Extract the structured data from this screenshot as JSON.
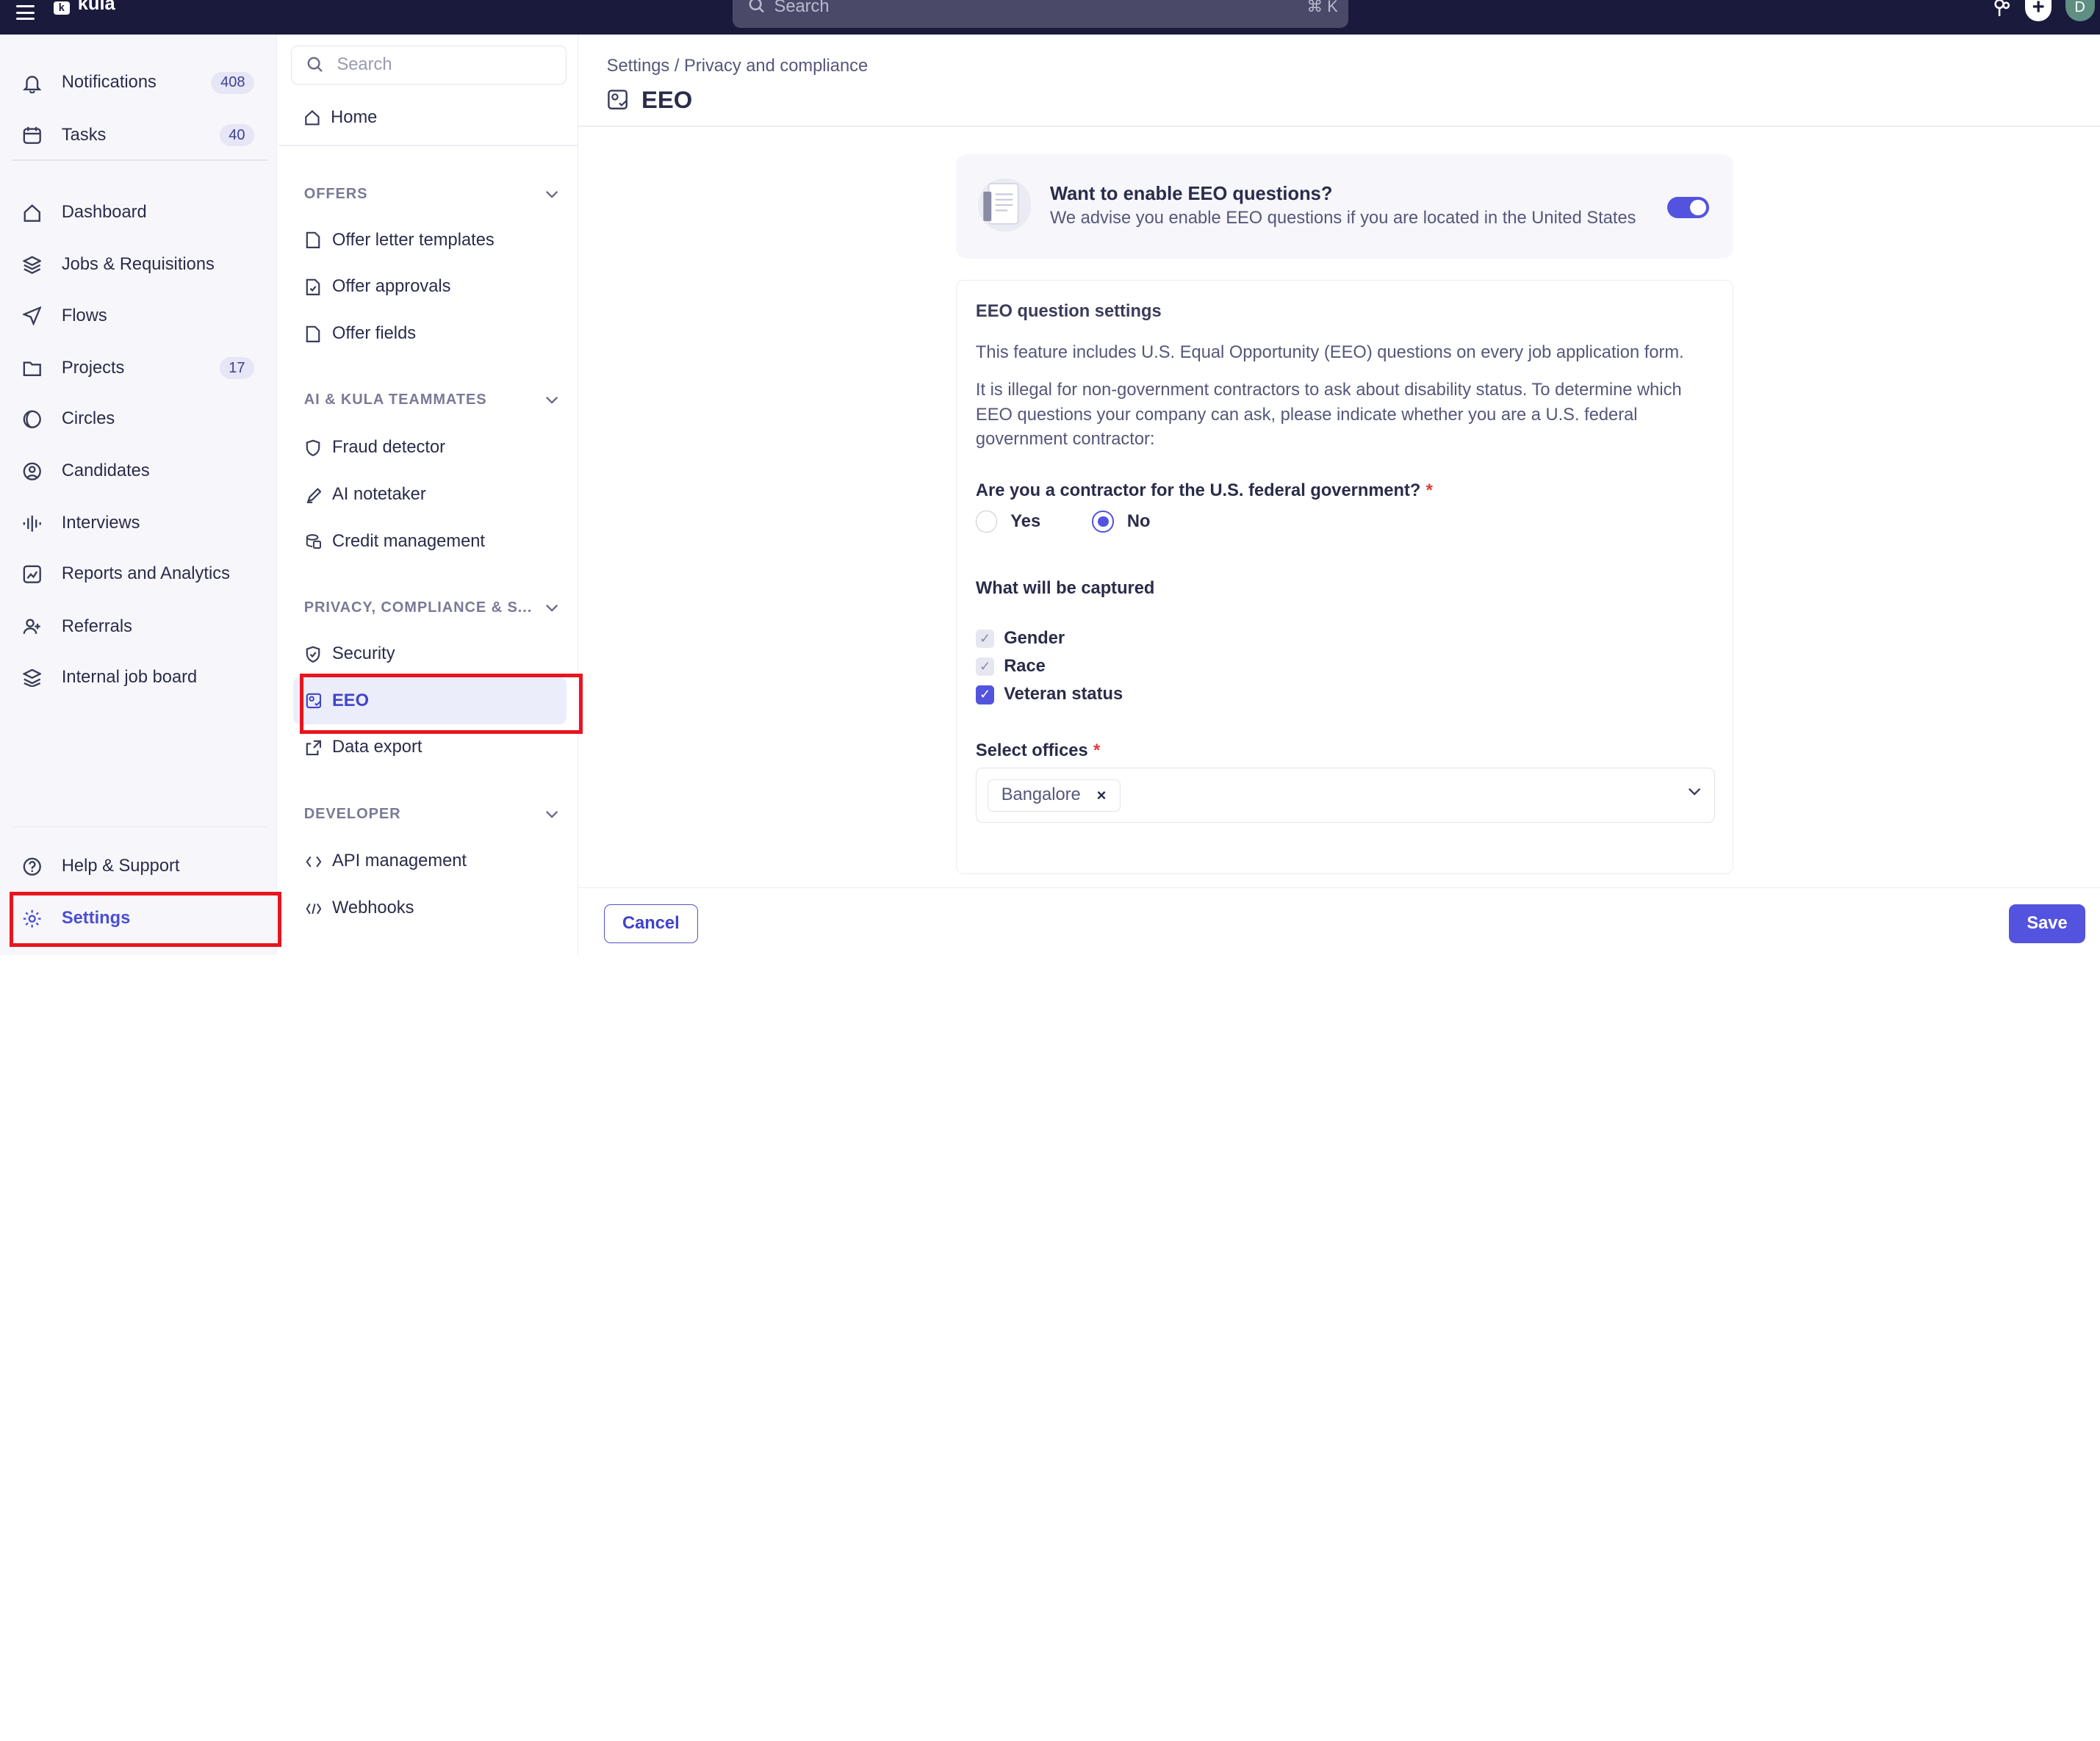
{
  "app": {
    "name": "kula"
  },
  "topbar": {
    "search_placeholder": "Search",
    "search_shortcut": "⌘ K",
    "avatar_initial": "D",
    "plus": "+"
  },
  "leftnav": {
    "items": [
      {
        "label": "Notifications",
        "badge": "408",
        "icon": "bell-icon"
      },
      {
        "label": "Tasks",
        "badge": "40",
        "icon": "calendar-icon"
      },
      {
        "label": "Dashboard",
        "badge": "",
        "icon": "home-icon"
      },
      {
        "label": "Jobs & Requisitions",
        "badge": "",
        "icon": "layers-icon"
      },
      {
        "label": "Flows",
        "badge": "",
        "icon": "send-icon"
      },
      {
        "label": "Projects",
        "badge": "17",
        "icon": "folder-icon"
      },
      {
        "label": "Circles",
        "badge": "",
        "icon": "circles-icon"
      },
      {
        "label": "Candidates",
        "badge": "",
        "icon": "user-circle-icon"
      },
      {
        "label": "Interviews",
        "badge": "",
        "icon": "waveform-icon"
      },
      {
        "label": "Reports and Analytics",
        "badge": "",
        "icon": "chart-icon"
      },
      {
        "label": "Referrals",
        "badge": "",
        "icon": "user-plus-icon"
      },
      {
        "label": "Internal job board",
        "badge": "",
        "icon": "stack-icon"
      }
    ],
    "help": "Help & Support",
    "settings": "Settings"
  },
  "subnav": {
    "search_placeholder": "Search",
    "home": "Home",
    "sections": {
      "offers": "OFFERS",
      "ai": "AI & KULA TEAMMATES",
      "privacy": "PRIVACY, COMPLIANCE & S...",
      "developer": "DEVELOPER"
    },
    "items": {
      "offer_letter_templates": "Offer letter templates",
      "offer_approvals": "Offer approvals",
      "offer_fields": "Offer fields",
      "fraud_detector": "Fraud detector",
      "ai_notetaker": "AI notetaker",
      "credit_management": "Credit management",
      "security": "Security",
      "eeo": "EEO",
      "data_export": "Data export",
      "api_management": "API management",
      "webhooks": "Webhooks"
    }
  },
  "main": {
    "breadcrumb": "Settings / Privacy and compliance",
    "title": "EEO",
    "enable": {
      "title": "Want to enable EEO questions?",
      "desc": "We advise you enable EEO questions if you are located in the United States",
      "enabled": true
    },
    "settings": {
      "title": "EEO question settings",
      "p1": "This feature includes U.S. Equal Opportunity (EEO) questions on every job application form.",
      "p2": "It is illegal for non-government contractors to ask about disability status. To determine which EEO questions your company can ask, please indicate whether you are a U.S. federal government contractor:",
      "question": "Are you a contractor for the U.S. federal government?",
      "required_mark": "*",
      "yes": "Yes",
      "no": "No",
      "selected": "No",
      "captured_title": "What will be captured",
      "captured": [
        {
          "label": "Gender",
          "checked": true,
          "locked": true
        },
        {
          "label": "Race",
          "checked": true,
          "locked": true
        },
        {
          "label": "Veteran status",
          "checked": true,
          "locked": false
        }
      ],
      "offices_label": "Select offices",
      "office_chip": "Bangalore",
      "chip_remove": "×"
    },
    "footer": {
      "cancel": "Cancel",
      "save": "Save"
    }
  },
  "colors": {
    "accent": "#5353e0",
    "topbar": "#1a1a3d",
    "highlight": "#e8141e"
  }
}
